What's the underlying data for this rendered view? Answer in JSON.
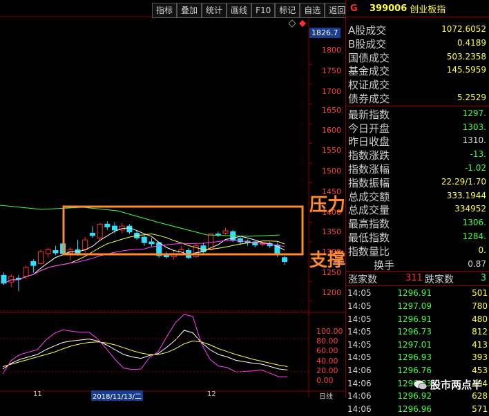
{
  "toolbar": {
    "buttons": [
      "指标",
      "叠加",
      "统计",
      "画线",
      "F10",
      "标记",
      "自选",
      "返回"
    ]
  },
  "chart": {
    "current_price_tag": "1826.7",
    "y_labels": [
      "1800",
      "1750",
      "1700",
      "1650",
      "1600",
      "1550",
      "1500",
      "1450",
      "1400",
      "1350",
      "1300",
      "1250",
      "1200"
    ],
    "indicator_labels": [
      "100.00",
      "80.00",
      "60.00",
      "40.00",
      "20.00",
      "0.00"
    ],
    "x_labels": [
      "11",
      "2018/11/13/二",
      "12"
    ],
    "bottom_right_label": "日线",
    "annotation_top": "压力位",
    "annotation_bottom": "支撑位",
    "colors": {
      "box": "#ff8a30",
      "bull": "#ff3030",
      "bear": "#30e0ff",
      "axis": "#8b0000"
    }
  },
  "panel": {
    "header": {
      "g": "G",
      "code": "399006",
      "name": "创业板指"
    },
    "group1": [
      {
        "label": "A股成交",
        "value": "1072.6052"
      },
      {
        "label": "B股成交",
        "value": "0.4189"
      },
      {
        "label": "国债成交",
        "value": "503.2358"
      },
      {
        "label": "基金成交",
        "value": "145.5959"
      },
      {
        "label": "权证成交",
        "value": ""
      },
      {
        "label": "债券成交",
        "value": "5.2529"
      }
    ],
    "group2": [
      {
        "label": "最新指数",
        "value": "1297."
      },
      {
        "label": "今日开盘",
        "value": "1303."
      },
      {
        "label": "昨日收盘",
        "value": "1310."
      },
      {
        "label": "指数涨跌",
        "value": "-13."
      },
      {
        "label": "指数涨幅",
        "value": "-1.02"
      },
      {
        "label": "指数振幅",
        "value": "22.29/1.70"
      },
      {
        "label": "总成交额",
        "value": "333.1944"
      },
      {
        "label": "总成交量",
        "value": "334952"
      },
      {
        "label": "最高指数",
        "value": "1306."
      },
      {
        "label": "最低指数",
        "value": "1284."
      },
      {
        "label": "指数量比",
        "value": "0."
      },
      {
        "label": "换手",
        "value": "0.87"
      }
    ],
    "stats": {
      "up_label": "涨家数",
      "up_value": "311",
      "down_label": "跌家数",
      "down_value": "3"
    },
    "trades": [
      {
        "time": "14:05",
        "price": "1296.91",
        "vol": "501"
      },
      {
        "time": "14:05",
        "price": "1297.09",
        "vol": "780"
      },
      {
        "time": "14:05",
        "price": "1296.91",
        "vol": "480"
      },
      {
        "time": "14:05",
        "price": "1296.73",
        "vol": "812"
      },
      {
        "time": "14:05",
        "price": "1297.01",
        "vol": "413"
      },
      {
        "time": "14:05",
        "price": "1296.93",
        "vol": "393"
      },
      {
        "time": "14:06",
        "price": "1296.76",
        "vol": "453"
      },
      {
        "time": "14:06",
        "price": "1296.83",
        "vol": "404"
      },
      {
        "time": "14:06",
        "price": "1296.92",
        "vol": "628"
      },
      {
        "time": "14:06",
        "price": "1296.96",
        "vol": "571"
      }
    ]
  },
  "watermark": {
    "text": "股市两点半"
  }
}
